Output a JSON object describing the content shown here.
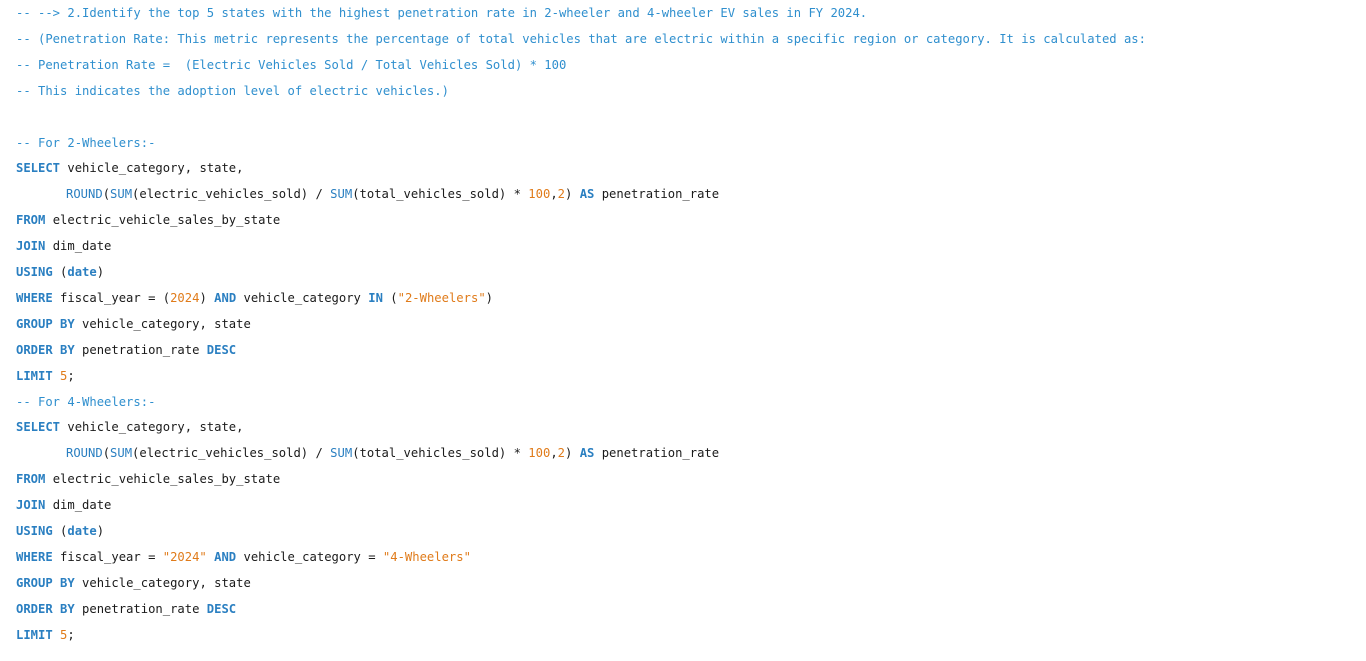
{
  "editor": {
    "lines": [
      [
        {
          "c": "cm",
          "t": "-- --> 2.Identify the top 5 states with the highest penetration rate in 2-wheeler and 4-wheeler EV sales in FY 2024."
        }
      ],
      [
        {
          "c": "cm",
          "t": "-- (Penetration Rate: This metric represents the percentage of total vehicles that are electric within a specific region or category. It is calculated as:"
        }
      ],
      [
        {
          "c": "cm",
          "t": "-- Penetration Rate =  (Electric Vehicles Sold / Total Vehicles Sold) * 100"
        }
      ],
      [
        {
          "c": "cm",
          "t": "-- This indicates the adoption level of electric vehicles.)"
        }
      ],
      [],
      [
        {
          "c": "cm",
          "t": "-- For 2-Wheelers:-"
        }
      ],
      [
        {
          "c": "kw",
          "t": "SELECT"
        },
        {
          "c": "id",
          "t": " vehicle_category, state,"
        }
      ],
      [
        {
          "c": "fn",
          "t": "ROUND"
        },
        {
          "c": "id",
          "t": "("
        },
        {
          "c": "fn",
          "t": "SUM"
        },
        {
          "c": "id",
          "t": "(electric_vehicles_sold) / "
        },
        {
          "c": "fn",
          "t": "SUM"
        },
        {
          "c": "id",
          "t": "(total_vehicles_sold) * "
        },
        {
          "c": "num",
          "t": "100"
        },
        {
          "c": "id",
          "t": ","
        },
        {
          "c": "num",
          "t": "2"
        },
        {
          "c": "id",
          "t": ") "
        },
        {
          "c": "kw",
          "t": "AS"
        },
        {
          "c": "id",
          "t": " penetration_rate"
        }
      ],
      [
        {
          "c": "kw",
          "t": "FROM"
        },
        {
          "c": "id",
          "t": " electric_vehicle_sales_by_state"
        }
      ],
      [
        {
          "c": "kw",
          "t": "JOIN"
        },
        {
          "c": "id",
          "t": " dim_date"
        }
      ],
      [
        {
          "c": "kw",
          "t": "USING"
        },
        {
          "c": "id",
          "t": " ("
        },
        {
          "c": "kw",
          "t": "date"
        },
        {
          "c": "id",
          "t": ")"
        }
      ],
      [
        {
          "c": "kw",
          "t": "WHERE"
        },
        {
          "c": "id",
          "t": " fiscal_year = ("
        },
        {
          "c": "num",
          "t": "2024"
        },
        {
          "c": "id",
          "t": ") "
        },
        {
          "c": "kw",
          "t": "AND"
        },
        {
          "c": "id",
          "t": " vehicle_category "
        },
        {
          "c": "kw",
          "t": "IN"
        },
        {
          "c": "id",
          "t": " ("
        },
        {
          "c": "str",
          "t": "\"2-Wheelers\""
        },
        {
          "c": "id",
          "t": ")"
        }
      ],
      [
        {
          "c": "kw",
          "t": "GROUP BY"
        },
        {
          "c": "id",
          "t": " vehicle_category, state"
        }
      ],
      [
        {
          "c": "kw",
          "t": "ORDER BY"
        },
        {
          "c": "id",
          "t": " penetration_rate "
        },
        {
          "c": "kw",
          "t": "DESC"
        }
      ],
      [
        {
          "c": "kw",
          "t": "LIMIT"
        },
        {
          "c": "id",
          "t": " "
        },
        {
          "c": "num",
          "t": "5"
        },
        {
          "c": "id",
          "t": ";"
        }
      ],
      [
        {
          "c": "cm",
          "t": "-- For 4-Wheelers:-"
        }
      ],
      [
        {
          "c": "kw",
          "t": "SELECT"
        },
        {
          "c": "id",
          "t": " vehicle_category, state,"
        }
      ],
      [
        {
          "c": "fn",
          "t": "ROUND"
        },
        {
          "c": "id",
          "t": "("
        },
        {
          "c": "fn",
          "t": "SUM"
        },
        {
          "c": "id",
          "t": "(electric_vehicles_sold) / "
        },
        {
          "c": "fn",
          "t": "SUM"
        },
        {
          "c": "id",
          "t": "(total_vehicles_sold) * "
        },
        {
          "c": "num",
          "t": "100"
        },
        {
          "c": "id",
          "t": ","
        },
        {
          "c": "num",
          "t": "2"
        },
        {
          "c": "id",
          "t": ") "
        },
        {
          "c": "kw",
          "t": "AS"
        },
        {
          "c": "id",
          "t": " penetration_rate"
        }
      ],
      [
        {
          "c": "kw",
          "t": "FROM"
        },
        {
          "c": "id",
          "t": " electric_vehicle_sales_by_state"
        }
      ],
      [
        {
          "c": "kw",
          "t": "JOIN"
        },
        {
          "c": "id",
          "t": " dim_date"
        }
      ],
      [
        {
          "c": "kw",
          "t": "USING"
        },
        {
          "c": "id",
          "t": " ("
        },
        {
          "c": "kw",
          "t": "date"
        },
        {
          "c": "id",
          "t": ")"
        }
      ],
      [
        {
          "c": "kw",
          "t": "WHERE"
        },
        {
          "c": "id",
          "t": " fiscal_year = "
        },
        {
          "c": "str",
          "t": "\"2024\""
        },
        {
          "c": "id",
          "t": " "
        },
        {
          "c": "kw",
          "t": "AND"
        },
        {
          "c": "id",
          "t": " vehicle_category = "
        },
        {
          "c": "str",
          "t": "\"4-Wheelers\""
        }
      ],
      [
        {
          "c": "kw",
          "t": "GROUP BY"
        },
        {
          "c": "id",
          "t": " vehicle_category, state"
        }
      ],
      [
        {
          "c": "kw",
          "t": "ORDER BY"
        },
        {
          "c": "id",
          "t": " penetration_rate "
        },
        {
          "c": "kw",
          "t": "DESC"
        }
      ],
      [
        {
          "c": "kw",
          "t": "LIMIT"
        },
        {
          "c": "id",
          "t": " "
        },
        {
          "c": "num",
          "t": "5"
        },
        {
          "c": "id",
          "t": ";"
        }
      ]
    ]
  },
  "colors": {
    "comment": "#2f8fce",
    "keyword": "#2a7fc1",
    "number": "#e07b1a",
    "string": "#e07b1a",
    "text": "#1a1a1a",
    "background": "#ffffff"
  }
}
